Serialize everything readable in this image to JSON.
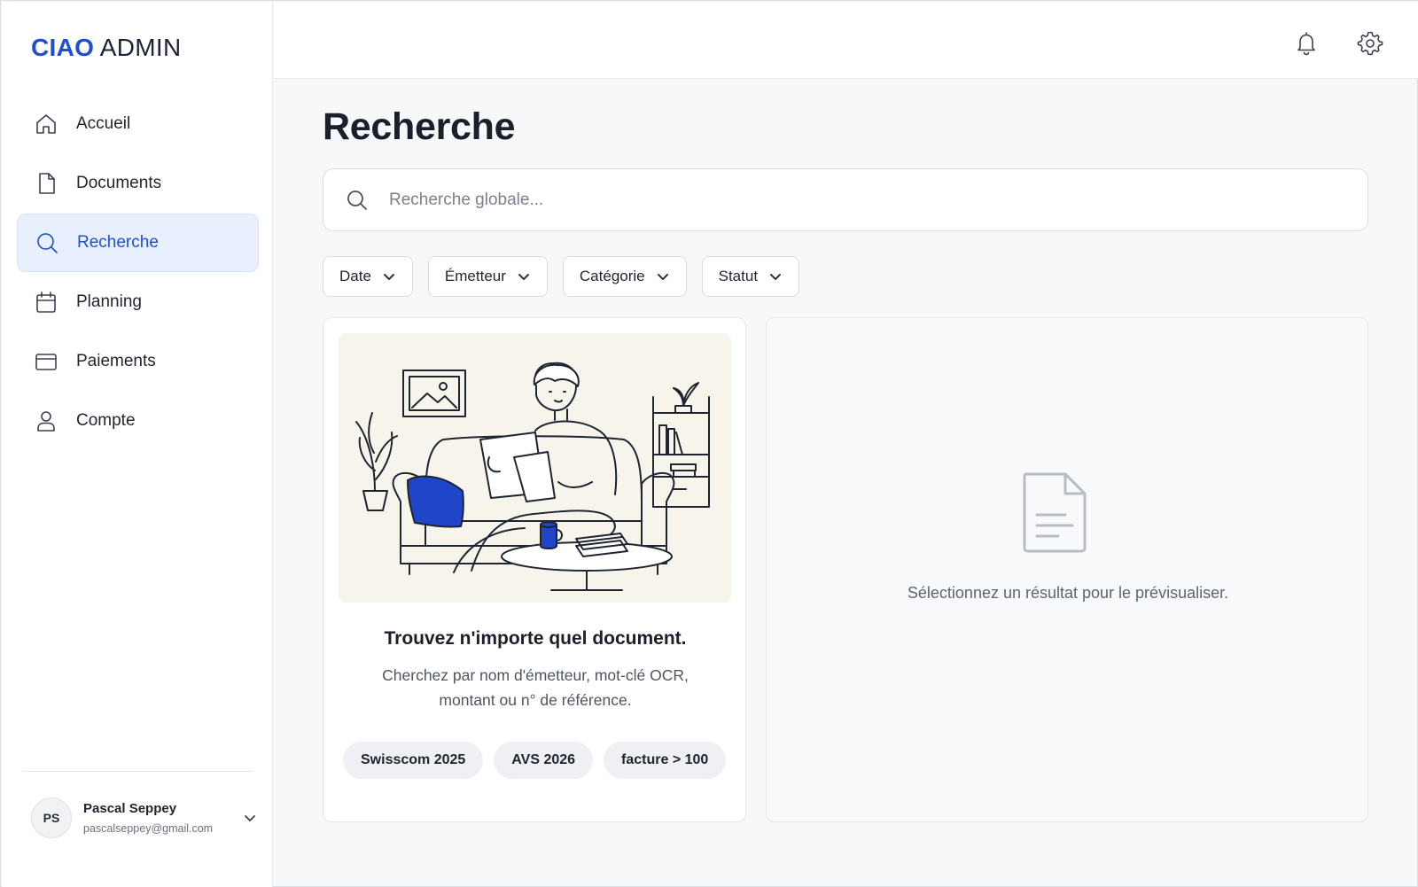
{
  "app": {
    "logo_brand": "CIAO",
    "logo_rest": "ADMIN"
  },
  "sidebar": {
    "items": [
      {
        "label": "Accueil",
        "icon": "home-icon"
      },
      {
        "label": "Documents",
        "icon": "document-icon"
      },
      {
        "label": "Recherche",
        "icon": "search-icon",
        "active": true
      },
      {
        "label": "Planning",
        "icon": "calendar-icon"
      },
      {
        "label": "Paiements",
        "icon": "card-icon"
      },
      {
        "label": "Compte",
        "icon": "user-icon"
      }
    ],
    "user": {
      "initials": "PS",
      "name": "Pascal Seppey",
      "email": "pascalseppey@gmail.com"
    }
  },
  "topbar": {
    "icons": [
      "bell-icon",
      "gear-icon"
    ]
  },
  "main": {
    "title": "Recherche",
    "search": {
      "placeholder": "Recherche globale...",
      "value": ""
    },
    "filters": [
      "Date",
      "Émetteur",
      "Catégorie",
      "Statut"
    ],
    "empty_card": {
      "title": "Trouvez n'importe quel document.",
      "description": "Cherchez par nom d'émetteur, mot-clé OCR, montant ou n° de référence.",
      "suggestions": [
        "Swisscom 2025",
        "AVS 2026",
        "facture > 100"
      ]
    },
    "preview": {
      "message": "Sélectionnez un résultat pour le prévisualiser."
    }
  },
  "colors": {
    "accent": "#1f4fd1",
    "active_bg": "#e9f0fd",
    "illustration_bg": "#f7f4ec",
    "cushion": "#1f45c8"
  }
}
